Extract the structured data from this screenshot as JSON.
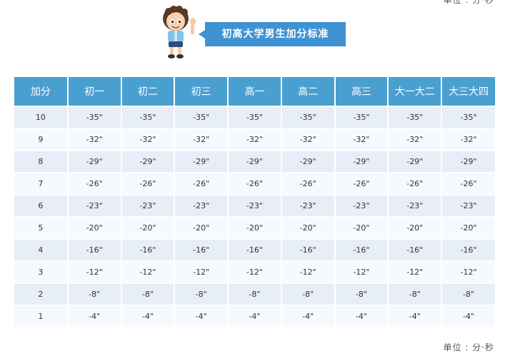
{
  "unit_top": "单位 : 分·秒",
  "unit_bottom": "单位 : 分·秒",
  "title": "初高大学男生加分标准",
  "table": {
    "headers": [
      "加分",
      "初一",
      "初二",
      "初三",
      "高一",
      "高二",
      "高三",
      "大一大二",
      "大三大四"
    ],
    "rows": [
      [
        "10",
        "-35\"",
        "-35\"",
        "-35\"",
        "-35\"",
        "-35\"",
        "-35\"",
        "-35\"",
        "-35\""
      ],
      [
        "9",
        "-32\"",
        "-32\"",
        "-32\"",
        "-32\"",
        "-32\"",
        "-32\"",
        "-32\"",
        "-32\""
      ],
      [
        "8",
        "-29\"",
        "-29\"",
        "-29\"",
        "-29\"",
        "-29\"",
        "-29\"",
        "-29\"",
        "-29\""
      ],
      [
        "7",
        "-26\"",
        "-26\"",
        "-26\"",
        "-26\"",
        "-26\"",
        "-26\"",
        "-26\"",
        "-26\""
      ],
      [
        "6",
        "-23\"",
        "-23\"",
        "-23\"",
        "-23\"",
        "-23\"",
        "-23\"",
        "-23\"",
        "-23\""
      ],
      [
        "5",
        "-20\"",
        "-20\"",
        "-20\"",
        "-20\"",
        "-20\"",
        "-20\"",
        "-20\"",
        "-20\""
      ],
      [
        "4",
        "-16\"",
        "-16\"",
        "-16\"",
        "-16\"",
        "-16\"",
        "-16\"",
        "-16\"",
        "-16\""
      ],
      [
        "3",
        "-12\"",
        "-12\"",
        "-12\"",
        "-12\"",
        "-12\"",
        "-12\"",
        "-12\"",
        "-12\""
      ],
      [
        "2",
        "-8\"",
        "-8\"",
        "-8\"",
        "-8\"",
        "-8\"",
        "-8\"",
        "-8\"",
        "-8\""
      ],
      [
        "1",
        "-4\"",
        "-4\"",
        "-4\"",
        "-4\"",
        "-4\"",
        "-4\"",
        "-4\"",
        "-4\""
      ]
    ]
  },
  "colors": {
    "header_bg": "#4a9fd1",
    "badge_bg": "#3f93d3",
    "row_odd": "#e7eef7",
    "row_even": "#f6f9fd"
  },
  "icons": {
    "mascot": "cartoon-boy-waving-icon"
  }
}
